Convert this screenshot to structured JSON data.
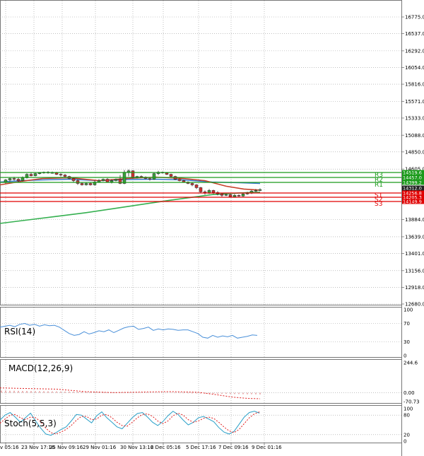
{
  "chart_data": {
    "type": "candlestick",
    "main": {
      "y_ticks": [
        "16775.0",
        "16537.0",
        "16292.0",
        "16054.0",
        "15816.0",
        "15571.0",
        "15333.0",
        "15088.0",
        "14850.0",
        "14605.0",
        "13884.0",
        "13639.0",
        "13401.0",
        "13156.0",
        "12918.0",
        "12680.0"
      ],
      "resistance": [
        {
          "name": "R3",
          "value": 14519.6,
          "tag": "14519.6",
          "color": "#1a9a1a"
        },
        {
          "name": "R2",
          "value": 14457.0,
          "tag": "14457.0",
          "color": "#1a9a1a"
        },
        {
          "name": "R1",
          "value": 14399.2,
          "tag": "14399.2",
          "color": "#1a9a1a"
        }
      ],
      "current_tag": "14312.0",
      "support": [
        {
          "name": "S1",
          "value": 14256.8,
          "tag": "14256.8",
          "color": "#e00000"
        },
        {
          "name": "S2",
          "value": 14205.3,
          "tag": "14205.3",
          "color": "#e00000"
        },
        {
          "name": "S3",
          "value": 14149.9,
          "tag": "14149.9",
          "color": "#e00000"
        }
      ]
    },
    "rsi": {
      "label": "RSI(14)",
      "ticks": [
        "100",
        "70",
        "30",
        "0"
      ]
    },
    "macd": {
      "label": "MACD(12,26,9)",
      "ticks": [
        "244.6",
        "0.00",
        "-70.73"
      ]
    },
    "stoch": {
      "label": "Stoch(5,5,3)",
      "ticks": [
        "100",
        "80",
        "20",
        "0"
      ]
    },
    "x_ticks": [
      "v 05:16",
      "23 Nov 17:16",
      "25 Nov 09:16",
      "29 Nov 01:16",
      "30 Nov 13:16",
      "2 Dec 05:16",
      "5 Dec 17:16",
      "7 Dec 09:16",
      "9 Dec 01:16"
    ],
    "colors": {
      "rsi": "#4a90d9",
      "stoch_k": "#2aa0c8",
      "stoch_d": "#e02020",
      "macd_hist": "#d04040",
      "macd_signal": "#e02020",
      "ma_fast": "#c8402a",
      "ma_mid": "#3a7ad0",
      "ma_slow": "#35b050"
    }
  }
}
